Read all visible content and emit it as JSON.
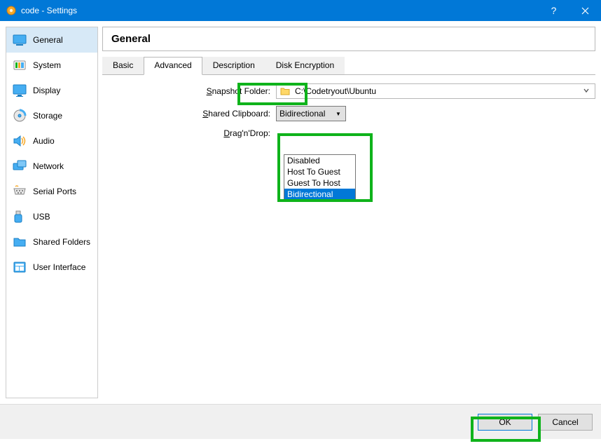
{
  "titlebar": {
    "title": "code - Settings"
  },
  "sidebar": {
    "items": [
      {
        "label": "General"
      },
      {
        "label": "System"
      },
      {
        "label": "Display"
      },
      {
        "label": "Storage"
      },
      {
        "label": "Audio"
      },
      {
        "label": "Network"
      },
      {
        "label": "Serial Ports"
      },
      {
        "label": "USB"
      },
      {
        "label": "Shared Folders"
      },
      {
        "label": "User Interface"
      }
    ],
    "selected": "General"
  },
  "main": {
    "heading": "General",
    "tabs": [
      {
        "label": "Basic"
      },
      {
        "label": "Advanced"
      },
      {
        "label": "Description"
      },
      {
        "label": "Disk Encryption"
      }
    ],
    "active_tab": "Advanced",
    "snapshot_label": "Snapshot Folder:",
    "snapshot_label_key": "S",
    "snapshot_path": "C:\\Codetryout\\Ubuntu",
    "clipboard_label": "Shared Clipboard:",
    "clipboard_label_key": "S",
    "clipboard_selected": "Bidirectional",
    "clipboard_options": [
      "Disabled",
      "Host To Guest",
      "Guest To Host",
      "Bidirectional"
    ],
    "dragdrop_label": "Drag'n'Drop:",
    "dragdrop_label_key": "D"
  },
  "buttons": {
    "ok": "OK",
    "cancel": "Cancel"
  }
}
